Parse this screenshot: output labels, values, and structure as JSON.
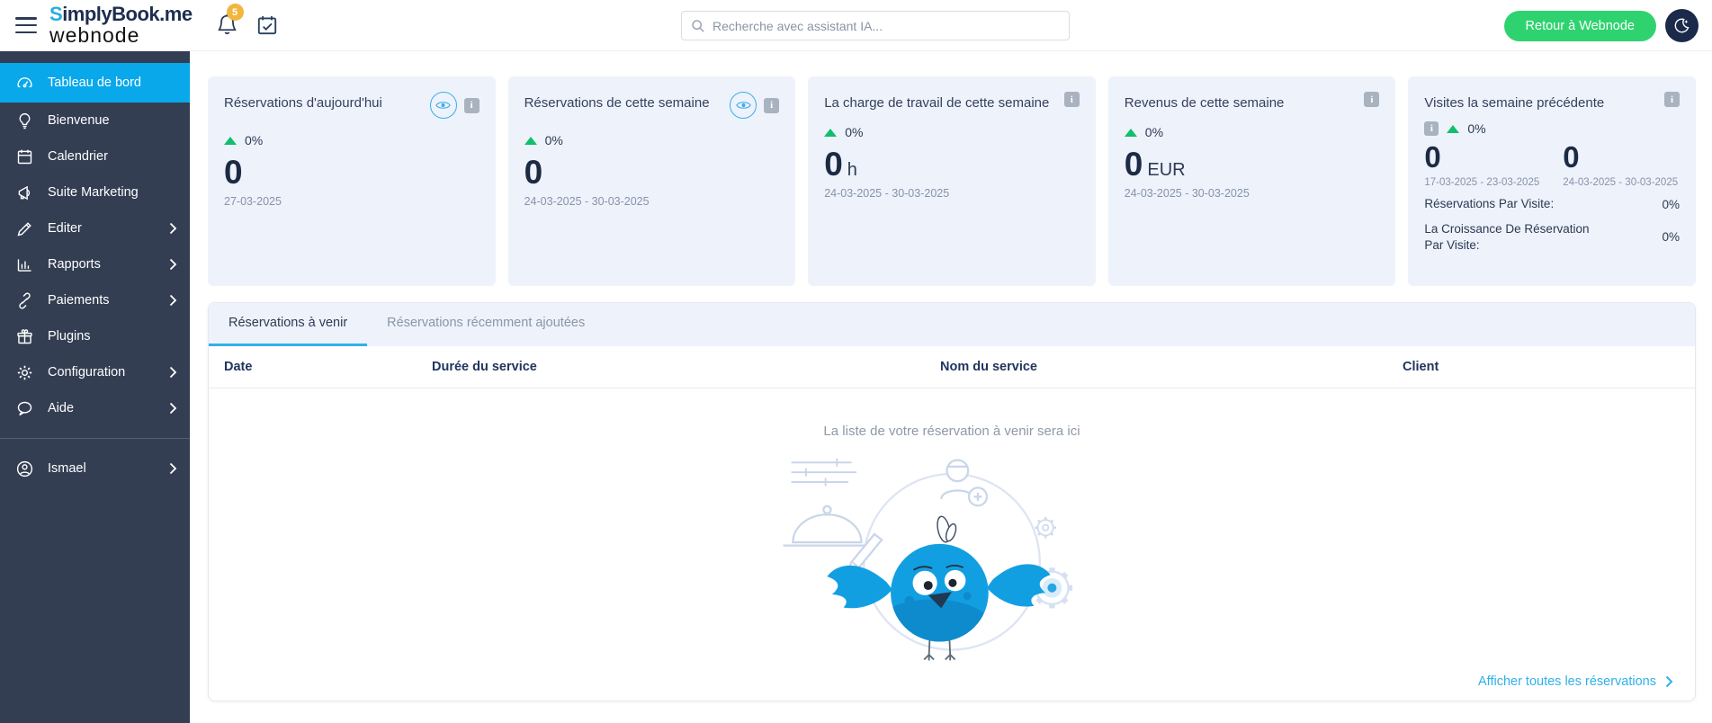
{
  "header": {
    "logo": {
      "part_s": "S",
      "part_rest": "implyBook",
      "part_me": ".me",
      "brand": "webnode"
    },
    "notification_count": "5",
    "search_placeholder": "Recherche avec assistant IA...",
    "back_button": "Retour à Webnode"
  },
  "sidebar": {
    "items": [
      {
        "label": "Tableau de bord",
        "icon": "dashboard-icon",
        "active": true
      },
      {
        "label": "Bienvenue",
        "icon": "lightbulb-icon"
      },
      {
        "label": "Calendrier",
        "icon": "calendar-icon"
      },
      {
        "label": "Suite Marketing",
        "icon": "megaphone-icon"
      },
      {
        "label": "Editer",
        "icon": "pencil-icon",
        "chevron": true
      },
      {
        "label": "Rapports",
        "icon": "chart-icon",
        "chevron": true
      },
      {
        "label": "Paiements",
        "icon": "links-icon",
        "chevron": true
      },
      {
        "label": "Plugins",
        "icon": "gift-icon"
      },
      {
        "label": "Configuration",
        "icon": "gear-icon",
        "chevron": true
      },
      {
        "label": "Aide",
        "icon": "chat-icon",
        "chevron": true
      }
    ],
    "user": {
      "label": "Ismael",
      "icon": "user-icon",
      "chevron": true
    }
  },
  "cards": [
    {
      "title": "Réservations d'aujourd'hui",
      "trend": "0%",
      "value": "0",
      "unit": "",
      "period": "27-03-2025"
    },
    {
      "title": "Réservations de cette semaine",
      "trend": "0%",
      "value": "0",
      "unit": "",
      "period": "24-03-2025 - 30-03-2025"
    },
    {
      "title": "La charge de travail de cette semaine",
      "trend": "0%",
      "value": "0",
      "unit": "h",
      "period": "24-03-2025 - 30-03-2025"
    },
    {
      "title": "Revenus de cette semaine",
      "trend": "0%",
      "value": "0",
      "unit": "EUR",
      "period": "24-03-2025 - 30-03-2025"
    },
    {
      "title": "Visites la semaine précédente",
      "trend": "0%",
      "columns": [
        {
          "value": "0",
          "period": "17-03-2025 - 23-03-2025"
        },
        {
          "value": "0",
          "period": "24-03-2025 - 30-03-2025"
        }
      ],
      "metrics": [
        {
          "label": "Réservations Par Visite:",
          "value": "0%"
        },
        {
          "label": "La Croissance De Réservation Par Visite:",
          "value": "0%"
        }
      ]
    }
  ],
  "reservations": {
    "tabs": [
      {
        "label": "Réservations à venir",
        "active": true
      },
      {
        "label": "Réservations récemment ajoutées",
        "active": false
      }
    ],
    "columns": [
      "Date",
      "Durée du service",
      "Nom du service",
      "Client"
    ],
    "rows": [],
    "empty_message": "La liste de votre réservation à venir sera ici",
    "footer_link": "Afficher toutes les réservations"
  },
  "colors": {
    "sidebar_bg": "#333e53",
    "accent_cyan": "#09a8ea",
    "link_cyan": "#2fb1e9",
    "button_green": "#2ed36f",
    "trend_green": "#10bf6b",
    "badge_orange": "#f2b53d",
    "card_bg": "#eef2fb",
    "dark_navy": "#1c2a44"
  }
}
